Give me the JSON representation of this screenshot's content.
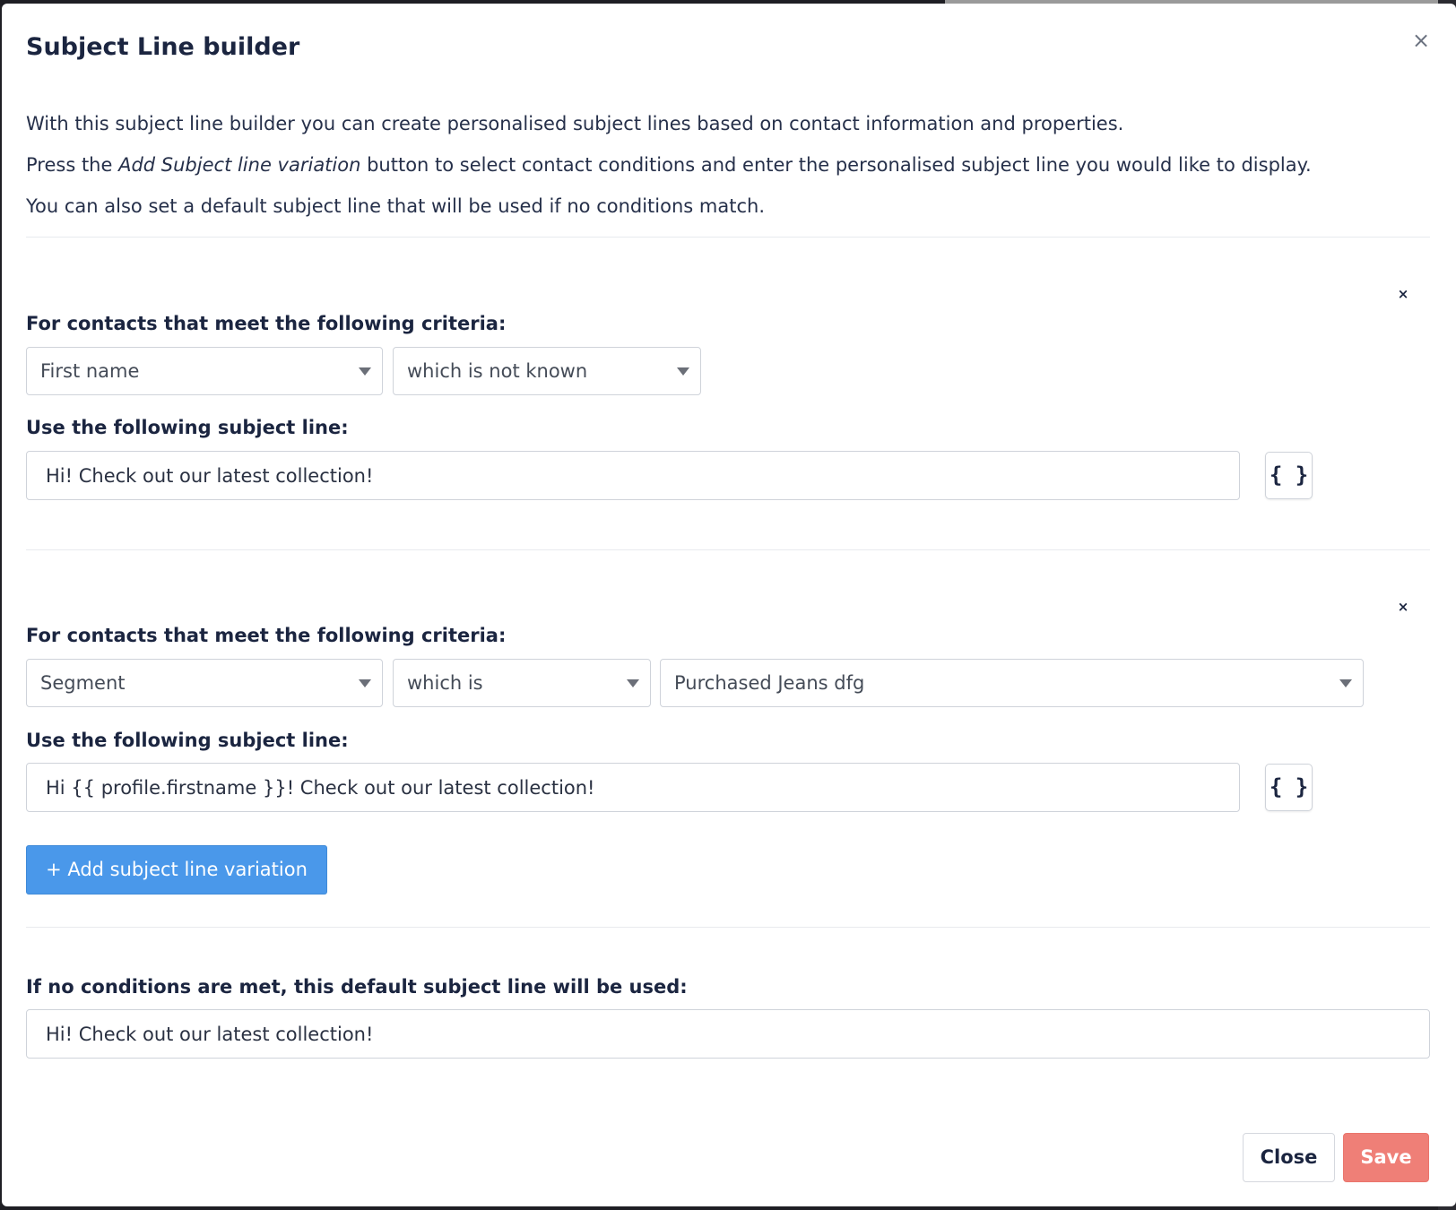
{
  "modal": {
    "title": "Subject Line builder",
    "close_symbol": "×"
  },
  "intro": {
    "line1": "With this subject line builder you can create personalised subject lines based on contact information and properties.",
    "line2_prefix": "Press the ",
    "line2_emphasis": "Add Subject line variation",
    "line2_suffix": " button to select contact conditions and enter the personalised subject line you would like to display.",
    "line3": "You can also set a default subject line that will be used if no conditions match."
  },
  "variations": [
    {
      "remove_symbol": "×",
      "criteria_label": "For contacts that meet the following criteria:",
      "field_select": "First name",
      "operator_select": "which is not known",
      "subject_label": "Use the following subject line:",
      "subject_value": "Hi! Check out our latest collection!",
      "insert_button_label": "{ }"
    },
    {
      "remove_symbol": "×",
      "criteria_label": "For contacts that meet the following criteria:",
      "field_select": "Segment",
      "operator_select": "which is",
      "value_select": "Purchased Jeans dfg",
      "subject_label": "Use the following subject line:",
      "subject_value": "Hi {{ profile.firstname }}! Check out our latest collection!",
      "insert_button_label": "{ }"
    }
  ],
  "add_variation_label": "+ Add subject line variation",
  "default": {
    "label": "If no conditions are met, this default subject line will be used:",
    "value": "Hi! Check out our latest collection!"
  },
  "footer": {
    "close_label": "Close",
    "save_label": "Save"
  },
  "colors": {
    "primary": "#4a98ea",
    "save": "#ef7f77",
    "heading": "#1b2540"
  }
}
